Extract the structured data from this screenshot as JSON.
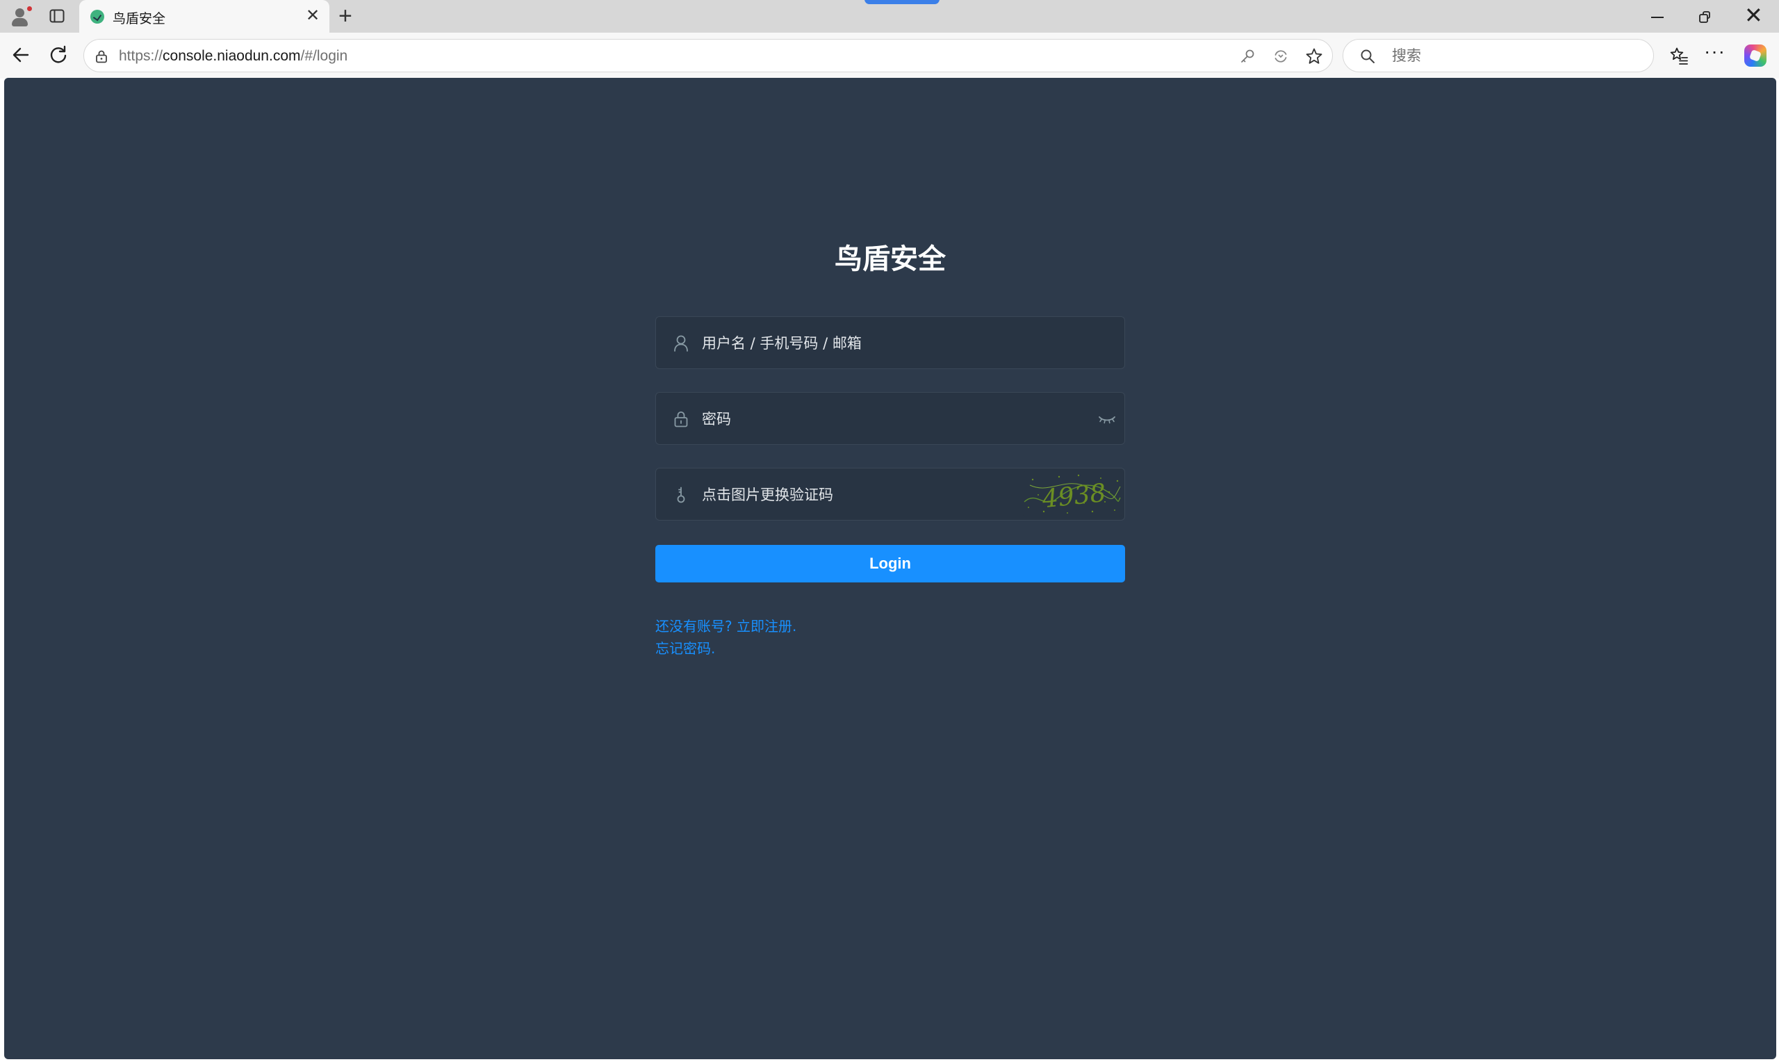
{
  "browser": {
    "tab": {
      "title": "鸟盾安全",
      "close_glyph": "✕"
    },
    "new_tab_glyph": "+",
    "window": {
      "close_glyph": "✕"
    },
    "address": {
      "scheme": "https://",
      "host": "console.niaodun.com",
      "path": "/#/login"
    },
    "search": {
      "placeholder": "搜索"
    },
    "more_glyph": "···",
    "icons": [
      "profile-icon",
      "tab-actions-icon",
      "back-arrow-icon",
      "refresh-icon",
      "site-info-lock-icon",
      "password-key-icon",
      "read-aloud-icon",
      "favorite-star-icon",
      "search-icon",
      "favorites-list-icon",
      "more-icon",
      "copilot-icon"
    ]
  },
  "login": {
    "title": "鸟盾安全",
    "username": {
      "placeholder": "用户名 / 手机号码 / 邮箱",
      "value": "",
      "icon": "user-icon"
    },
    "password": {
      "placeholder": "密码",
      "value": "",
      "icon": "lock-icon",
      "toggle_icon": "eye-closed-icon"
    },
    "captcha": {
      "placeholder": "点击图片更换验证码",
      "value": "",
      "icon": "key-icon",
      "image_text": "4938"
    },
    "submit_label": "Login",
    "register_link": "还没有账号? 立即注册.",
    "forgot_link": "忘记密码."
  },
  "colors": {
    "page_background": "#2d3a4b",
    "input_background": "#283443",
    "primary": "#1890ff",
    "title": "#ffffff",
    "captcha_text": "#6b8e23"
  }
}
